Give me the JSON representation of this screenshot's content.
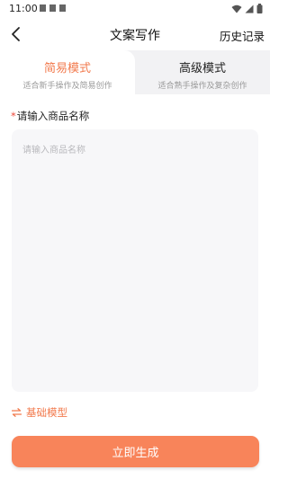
{
  "status_bar": {
    "time": "11:00"
  },
  "header": {
    "title": "文案写作",
    "history_label": "历史记录"
  },
  "tabs": [
    {
      "label": "简易模式",
      "subtitle": "适合新手操作及简易创作",
      "active": true
    },
    {
      "label": "高级模式",
      "subtitle": "适合熟手操作及复杂创作",
      "active": false
    }
  ],
  "form": {
    "required_mark": "*",
    "product_name_label": "请输入商品名称",
    "product_name_placeholder": "请输入商品名称",
    "product_name_value": ""
  },
  "model": {
    "label": "基础模型",
    "icon": "swap-icon"
  },
  "actions": {
    "generate_label": "立即生成"
  },
  "colors": {
    "accent": "#f27a4d",
    "button": "#f8845a",
    "required": "#ee4a3c"
  }
}
